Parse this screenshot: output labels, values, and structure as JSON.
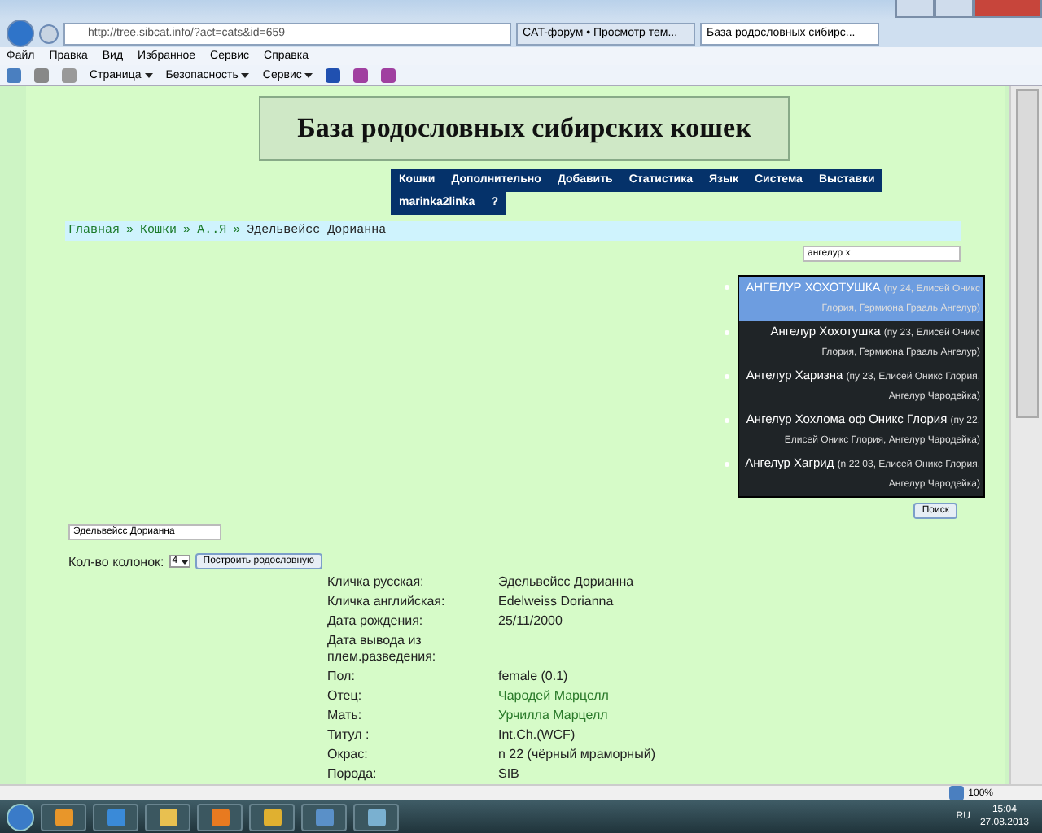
{
  "browser": {
    "address": "http://tree.sibcat.info/?act=cats&id=659",
    "tabs": [
      {
        "label": "CAT-форум • Просмотр тем...",
        "selected": false
      },
      {
        "label": "База родословных сибирс...",
        "selected": true
      }
    ],
    "menu": [
      "Файл",
      "Правка",
      "Вид",
      "Избранное",
      "Сервис",
      "Справка"
    ],
    "commands": [
      "Страница",
      "Безопасность",
      "Сервис"
    ]
  },
  "page": {
    "banner": "База родословных сибирских кошек",
    "nav": [
      "Кошки",
      "Дополнительно",
      "Добавить",
      "Статистика",
      "Язык",
      "Система",
      "Выставки",
      "marinka2linka",
      "?"
    ],
    "breadcrumb": [
      {
        "label": "Главная",
        "kind": "link"
      },
      {
        "label": "Кошки",
        "kind": "link"
      },
      {
        "label": "А..Я",
        "kind": "link"
      },
      {
        "label": "Эдельвейсс Дорианна",
        "kind": "current"
      }
    ],
    "breadcrumb_separator": "»",
    "search": {
      "value": "ангелур х",
      "button": "Поиск"
    },
    "suggestions": [
      {
        "name": "АНГЕЛУР ХОХОТУШКА",
        "detail": "(пу 24, Елисей Оникс Глория, Гермиона Грааль Ангелур)",
        "selected": true
      },
      {
        "name": "Ангелур Хохотушка",
        "detail": "(пу 23, Елисей Оникс Глория, Гермиона Грааль Ангелур)",
        "selected": false
      },
      {
        "name": "Ангелур Харизна",
        "detail": "(пу 23, Елисей Оникс Глория, Ангелур Чародейка)",
        "selected": false
      },
      {
        "name": "Ангелур Хохлома оф Оникс Глория",
        "detail": "(пу 22, Елисей Оникс Глория, Ангелур Чародейка)",
        "selected": false
      },
      {
        "name": "Ангелур Хагрид",
        "detail": "(n 22 03, Елисей Оникс Глория, Ангелур Чародейка)",
        "selected": false
      }
    ],
    "name_field": {
      "value": "Эдельвейсс Дорианна"
    },
    "columns": {
      "label": "Кол-во колонок:",
      "value": "4",
      "button": "Построить родословную"
    },
    "details": [
      {
        "label": "Кличка русская:",
        "value": "Эдельвейсс Дорианна",
        "kind": "text"
      },
      {
        "label": "Кличка английская:",
        "value": "Edelweiss Dorianna",
        "kind": "text"
      },
      {
        "label": "Дата рождения:",
        "value": "25/11/2000",
        "kind": "text"
      },
      {
        "label": "Дата вывода из плем.разведения:",
        "kind": "text"
      },
      {
        "label": "Пол:",
        "value": "female (0.1)",
        "kind": "text"
      },
      {
        "label": "Отец:",
        "value": "Чародей Марцелл",
        "kind": "link"
      },
      {
        "label": "Мать:",
        "value": "Урчилла Марцелл",
        "kind": "link"
      },
      {
        "label": "Титул :",
        "value": "Int.Ch.(WCF)",
        "kind": "text"
      },
      {
        "label": "Окрас:",
        "value": "n 22 (чёрный мраморный)",
        "kind": "text"
      },
      {
        "label": "Порода:",
        "value": "SIB",
        "kind": "text"
      }
    ]
  },
  "status_bar": {
    "zoom": "100%"
  },
  "taskbar": {
    "language": "RU",
    "time": "15:04",
    "date": "27.08.2013"
  }
}
